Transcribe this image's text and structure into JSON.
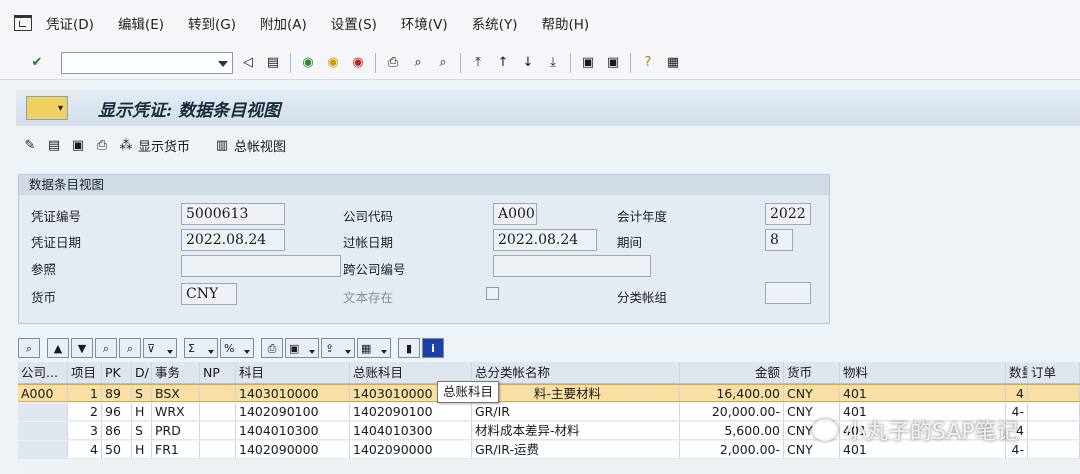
{
  "menu": [
    "凭证(D)",
    "编辑(E)",
    "转到(G)",
    "附加(A)",
    "设置(S)",
    "环境(V)",
    "系统(Y)",
    "帮助(H)"
  ],
  "title": "显示凭证: 数据条目视图",
  "app_toolbar": {
    "display_currency": "显示货币",
    "gl_view": "总帐视图"
  },
  "group": {
    "header": "数据条目视图",
    "doc_no_label": "凭证编号",
    "doc_no": "5000613",
    "company_label": "公司代码",
    "company": "A000",
    "fiscal_year_label": "会计年度",
    "fiscal_year": "2022",
    "doc_date_label": "凭证日期",
    "doc_date": "2022.08.24",
    "posting_date_label": "过帐日期",
    "posting_date": "2022.08.24",
    "period_label": "期间",
    "period": "8",
    "reference_label": "参照",
    "reference": "",
    "cross_company_label": "跨公司编号",
    "cross_company": "",
    "currency_label": "货币",
    "currency": "CNY",
    "text_exists_label": "文本存在",
    "ledger_group_label": "分类帐组",
    "ledger_group": ""
  },
  "table": {
    "headers": [
      "公司...",
      "项目",
      "PK",
      "D/",
      "事务",
      "NP",
      "科目",
      "总账科目",
      "总分类帐名称",
      "金额",
      "货币",
      "物料",
      "数量",
      "订单"
    ],
    "rows": [
      [
        "A000",
        "1",
        "89",
        "S",
        "BSX",
        "",
        "1403010000",
        "1403010000",
        "料-主要材料",
        "16,400.00",
        "CNY",
        "401",
        "4",
        ""
      ],
      [
        "",
        "2",
        "96",
        "H",
        "WRX",
        "",
        "1402090100",
        "1402090100",
        "GR/IR",
        "20,000.00-",
        "CNY",
        "401",
        "4-",
        ""
      ],
      [
        "",
        "3",
        "86",
        "S",
        "PRD",
        "",
        "1404010300",
        "1404010300",
        "材料成本差异-材料",
        "5,600.00",
        "CNY",
        "401",
        "4",
        ""
      ],
      [
        "",
        "4",
        "50",
        "H",
        "FR1",
        "",
        "1402090000",
        "1402090000",
        "GR/IR-运费",
        "2,000.00-",
        "CNY",
        "401",
        "4-",
        ""
      ]
    ]
  },
  "tooltip": "总账科目",
  "watermark": "小丸子的SAP笔记"
}
